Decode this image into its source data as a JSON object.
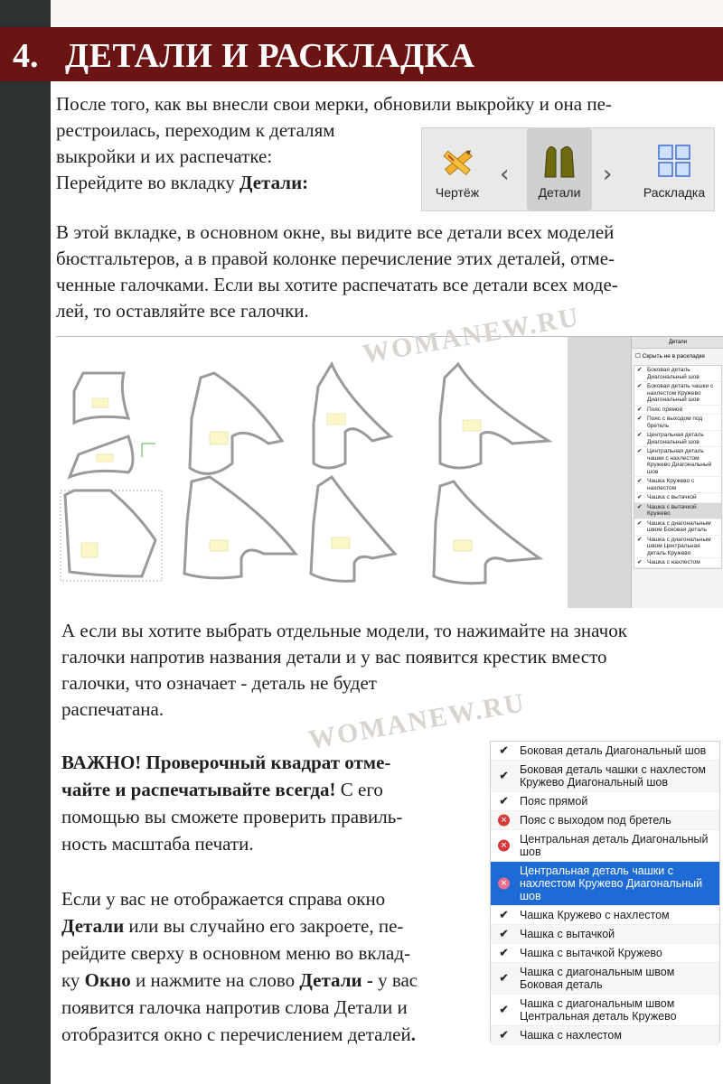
{
  "header": {
    "number": "4.",
    "title": "ДЕТАЛИ И РАСКЛАДКА"
  },
  "intro": {
    "line1": "После того, как вы внесли свои мерки, обновили выкройку и она пе-",
    "line2": "рестроилась, переходим к деталям",
    "line3": "выкройки и их распечатке:",
    "line4_prefix": "Перейдите во вкладку ",
    "line4_bold": "Детали:"
  },
  "toolbar": {
    "draft": "Чертёж",
    "details": "Детали",
    "layout": "Раскладка",
    "prev": "‹",
    "next": "›"
  },
  "para2": {
    "line1": "В этой вкладке, в основном окне, вы видите все детали всех моделей",
    "line2": "бюстгальтеров, а в правой колонке перечисление этих деталей, отме-",
    "line3": "ченные галочками. Если вы хотите распечатать все детали всех моде-",
    "line4": "лей, то оставляйте все галочки."
  },
  "watermark": "WOMANEW.RU",
  "panel": {
    "title": "Детали",
    "hide_label": "Скрыть не в раскладке",
    "items": [
      "Боковая деталь Диагональный шов",
      "Боковая деталь чашки с нахлестом Кружево Диагональный шов",
      "Пояс прямой",
      "Пояс с выходом под бретель",
      "Центральная деталь Диагональный шов",
      "Центральная деталь чашки с нахлестом Кружево Диагональный шов",
      "Чашка Кружево с нахлестом",
      "Чашка с вытачкой",
      "Чашка с вытачкой Кружево",
      "Чашка с диагональным швом Боковая деталь",
      "Чашка с диагональным швом Центральная деталь Кружево",
      "Чашка с нахлестом"
    ]
  },
  "para3": {
    "line1": "А если вы хотите выбрать отдельные модели, то нажимайте на значок",
    "line2": "галочки напротив названия детали и у вас появится крестик вместо",
    "line3": "галочки, что означает - деталь не будет",
    "line4": "распечатана."
  },
  "important": {
    "bold1": "ВАЖНО! Проверочный квадрат отме-",
    "bold2": "чайте и распечатывайте всегда!",
    "rest2": " С его",
    "line3": "помощью вы сможете проверить правиль-",
    "line4": "ность масштаба печати."
  },
  "para4": {
    "l1": "Если у вас не отображается справа окно",
    "l2_bold": "Детали",
    "l2_rest": " или вы случайно его закроете, пе-",
    "l3": "рейдите сверху в основном меню во вклад-",
    "l4_a": "ку ",
    "l4_bold1": "Окно",
    "l4_b": " и нажмите на слово ",
    "l4_bold2": "Детали -",
    "l4_c": " у вас",
    "l5": "появится галочка напротив слова Детали и",
    "l6_a": "отобразится окно с перечислением деталей",
    "l6_bold": "."
  },
  "list": {
    "rows": [
      {
        "label": "Боковая деталь Диагональный шов",
        "state": "check"
      },
      {
        "label": "Боковая деталь чашки с нахлестом Кружево Диагональный шов",
        "state": "check"
      },
      {
        "label": "Пояс прямой",
        "state": "check"
      },
      {
        "label": "Пояс с выходом под бретель",
        "state": "cross"
      },
      {
        "label": "Центральная деталь Диагональный шов",
        "state": "cross"
      },
      {
        "label": "Центральная деталь чашки с нахлестом Кружево Диагональный шов",
        "state": "cross"
      },
      {
        "label": "Чашка Кружево с нахлестом",
        "state": "check"
      },
      {
        "label": "Чашка с вытачкой",
        "state": "check"
      },
      {
        "label": "Чашка с вытачкой Кружево",
        "state": "check"
      },
      {
        "label": "Чашка с диагональным швом Боковая деталь",
        "state": "check"
      },
      {
        "label": "Чашка с диагональным швом Центральная деталь Кружево",
        "state": "check"
      },
      {
        "label": "Чашка с нахлестом",
        "state": "check"
      }
    ]
  },
  "colors": {
    "banner": "#6b1414",
    "selected": "#1f6bd6",
    "cross": "#d63a3a"
  }
}
